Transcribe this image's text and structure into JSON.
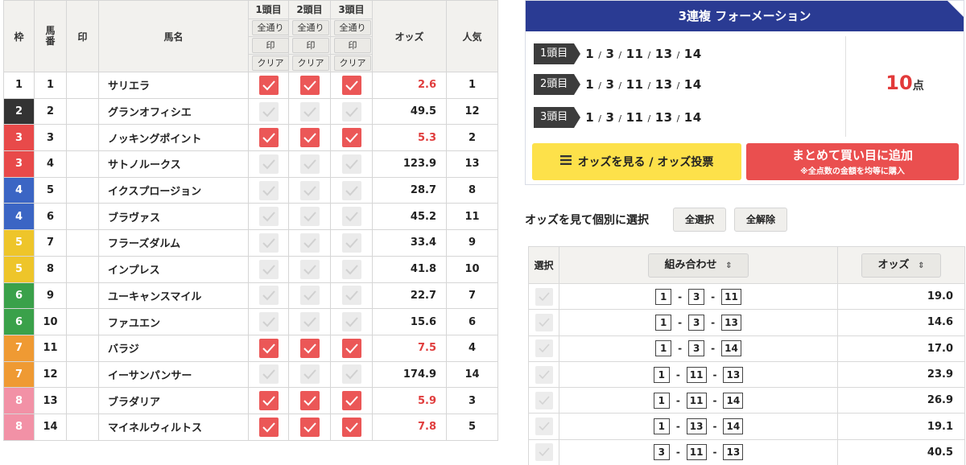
{
  "header": {
    "waku": "枠",
    "umaban": "馬番",
    "mark": "印",
    "name": "馬名",
    "odds": "オッズ",
    "popularity": "人気",
    "cols": [
      {
        "label": "1頭目",
        "all": "全通り",
        "mark": "印",
        "clear": "クリア"
      },
      {
        "label": "2頭目",
        "all": "全通り",
        "mark": "印",
        "clear": "クリア"
      },
      {
        "label": "3頭目",
        "all": "全通り",
        "mark": "印",
        "clear": "クリア"
      }
    ]
  },
  "colors": {
    "checked": "#eb5757",
    "unchecked": "#ebebeb",
    "odds_hot": "#e03d3d",
    "title_bar": "#2a3b93"
  },
  "horses": [
    {
      "waku": "1",
      "umaban": "1",
      "name": "サリエラ",
      "odds": "2.6",
      "pop": "1",
      "checked": true
    },
    {
      "waku": "2",
      "umaban": "2",
      "name": "グランオフィシエ",
      "odds": "49.5",
      "pop": "12",
      "checked": false
    },
    {
      "waku": "3",
      "umaban": "3",
      "name": "ノッキングポイント",
      "odds": "5.3",
      "pop": "2",
      "checked": true
    },
    {
      "waku": "3",
      "umaban": "4",
      "name": "サトノルークス",
      "odds": "123.9",
      "pop": "13",
      "checked": false
    },
    {
      "waku": "4",
      "umaban": "5",
      "name": "イクスプロージョン",
      "odds": "28.7",
      "pop": "8",
      "checked": false
    },
    {
      "waku": "4",
      "umaban": "6",
      "name": "ブラヴァス",
      "odds": "45.2",
      "pop": "11",
      "checked": false
    },
    {
      "waku": "5",
      "umaban": "7",
      "name": "フラーズダルム",
      "odds": "33.4",
      "pop": "9",
      "checked": false
    },
    {
      "waku": "5",
      "umaban": "8",
      "name": "インプレス",
      "odds": "41.8",
      "pop": "10",
      "checked": false
    },
    {
      "waku": "6",
      "umaban": "9",
      "name": "ユーキャンスマイル",
      "odds": "22.7",
      "pop": "7",
      "checked": false
    },
    {
      "waku": "6",
      "umaban": "10",
      "name": "ファユエン",
      "odds": "15.6",
      "pop": "6",
      "checked": false
    },
    {
      "waku": "7",
      "umaban": "11",
      "name": "バラジ",
      "odds": "7.5",
      "pop": "4",
      "checked": true
    },
    {
      "waku": "7",
      "umaban": "12",
      "name": "イーサンパンサー",
      "odds": "174.9",
      "pop": "14",
      "checked": false
    },
    {
      "waku": "8",
      "umaban": "13",
      "name": "ブラダリア",
      "odds": "5.9",
      "pop": "3",
      "checked": true
    },
    {
      "waku": "8",
      "umaban": "14",
      "name": "マイネルウィルトス",
      "odds": "7.8",
      "pop": "5",
      "checked": true
    }
  ],
  "waku_colors": {
    "1": {
      "bg": "#ffffff",
      "fg": "#222222"
    },
    "2": {
      "bg": "#333333",
      "fg": "#ffffff"
    },
    "3": {
      "bg": "#e84a4a",
      "fg": "#ffffff"
    },
    "4": {
      "bg": "#3b65c4",
      "fg": "#ffffff"
    },
    "5": {
      "bg": "#eec52a",
      "fg": "#ffffff"
    },
    "6": {
      "bg": "#3aa14a",
      "fg": "#ffffff"
    },
    "7": {
      "bg": "#ef9a33",
      "fg": "#ffffff"
    },
    "8": {
      "bg": "#f291a6",
      "fg": "#ffffff"
    }
  },
  "formation": {
    "title": "3連複 フォーメーション",
    "rows": [
      {
        "label": "1頭目",
        "nums": [
          "1",
          "3",
          "11",
          "13",
          "14"
        ]
      },
      {
        "label": "2頭目",
        "nums": [
          "1",
          "3",
          "11",
          "13",
          "14"
        ]
      },
      {
        "label": "3頭目",
        "nums": [
          "1",
          "3",
          "11",
          "13",
          "14"
        ]
      }
    ],
    "points_value": "10",
    "points_unit": "点",
    "view_odds_button": "オッズを見る / オッズ投票",
    "add_button": "まとめて買い目に追加",
    "add_button_note": "※全点数の金額を均等に購入"
  },
  "individual": {
    "title": "オッズを見て個別に選択",
    "select_all": "全選択",
    "deselect_all": "全解除",
    "col_select": "選択",
    "col_combo": "組み合わせ",
    "col_odds": "オッズ",
    "sort_icon": "sort-updown-icon",
    "dash": "-",
    "rows": [
      {
        "a": "1",
        "b": "3",
        "c": "11",
        "odds": "19.0"
      },
      {
        "a": "1",
        "b": "3",
        "c": "13",
        "odds": "14.6"
      },
      {
        "a": "1",
        "b": "3",
        "c": "14",
        "odds": "17.0"
      },
      {
        "a": "1",
        "b": "11",
        "c": "13",
        "odds": "23.9"
      },
      {
        "a": "1",
        "b": "11",
        "c": "14",
        "odds": "26.9"
      },
      {
        "a": "1",
        "b": "13",
        "c": "14",
        "odds": "19.1"
      },
      {
        "a": "3",
        "b": "11",
        "c": "13",
        "odds": "40.5"
      }
    ]
  }
}
